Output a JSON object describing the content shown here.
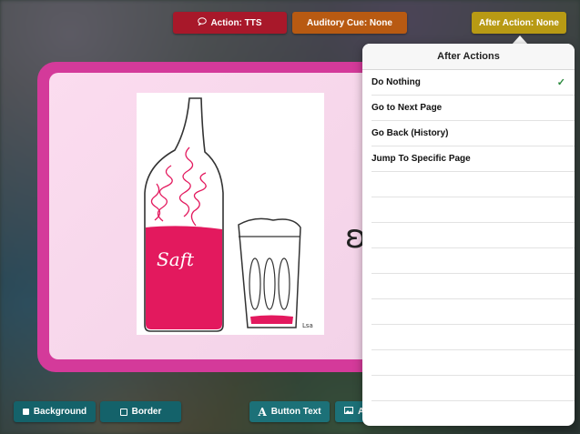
{
  "toolbar": {
    "action_label": "Action: TTS",
    "auditory_cue_label": "Auditory Cue: None",
    "after_action_label": "After Action: None"
  },
  "card": {
    "drawing_text": "Saft",
    "signature": "Lsa"
  },
  "bottom_bar": {
    "background_label": "Background",
    "border_label": "Border",
    "button_text_label": "Button Text",
    "image_label": "A"
  },
  "popover": {
    "title": "After Actions",
    "items": [
      {
        "label": "Do Nothing",
        "selected": true
      },
      {
        "label": "Go to Next Page",
        "selected": false
      },
      {
        "label": "Go Back (History)",
        "selected": false
      },
      {
        "label": "Jump To Specific Page",
        "selected": false
      }
    ],
    "check_mark": "✓"
  },
  "colors": {
    "action": "#a8182a",
    "auditory_cue": "#b85a12",
    "after_action": "#b89a14",
    "card_border": "#d43a9a",
    "bottom_buttons": "#14626a"
  }
}
